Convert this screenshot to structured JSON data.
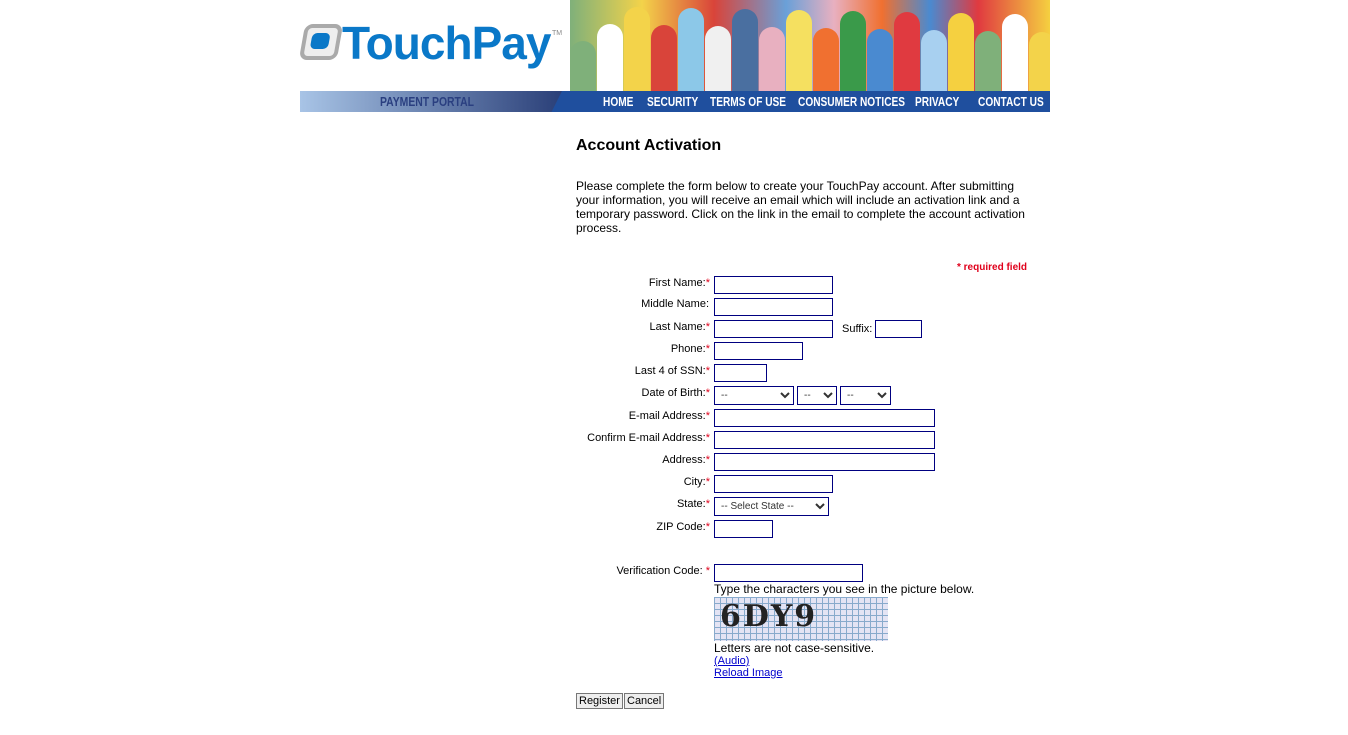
{
  "brand": {
    "name": "TouchPay",
    "tm": "TM",
    "portal": "PAYMENT PORTAL"
  },
  "nav": [
    "HOME",
    "SECURITY",
    "TERMS OF USE",
    "CONSUMER NOTICES",
    "PRIVACY",
    "CONTACT US"
  ],
  "title": "Account Activation",
  "intro": "Please complete the form below to create your TouchPay account. After submitting your information, you will receive an email which will include an activation link and a temporary password. Click on the link in the email to complete the account activation process.",
  "required_note": "* required field",
  "fields": {
    "first_name": "First Name:",
    "middle_name": "Middle Name:",
    "last_name": "Last Name:",
    "suffix": "Suffix:",
    "phone": "Phone:",
    "ssn": "Last 4 of SSN:",
    "dob": "Date of Birth:",
    "email": "E-mail Address:",
    "confirm_email": "Confirm E-mail Address:",
    "address": "Address:",
    "city": "City:",
    "state": "State:",
    "zip": "ZIP Code:",
    "verification": "Verification Code: "
  },
  "asterisk": "*",
  "dob_placeholder": "--",
  "state_placeholder": "-- Select State --",
  "captcha": {
    "instruction": "Type the characters you see in the picture below.",
    "image_text": "6DY9",
    "note": "Letters are not case-sensitive.",
    "audio": "(Audio)",
    "reload": "Reload Image"
  },
  "buttons": {
    "register": "Register",
    "cancel": "Cancel"
  }
}
